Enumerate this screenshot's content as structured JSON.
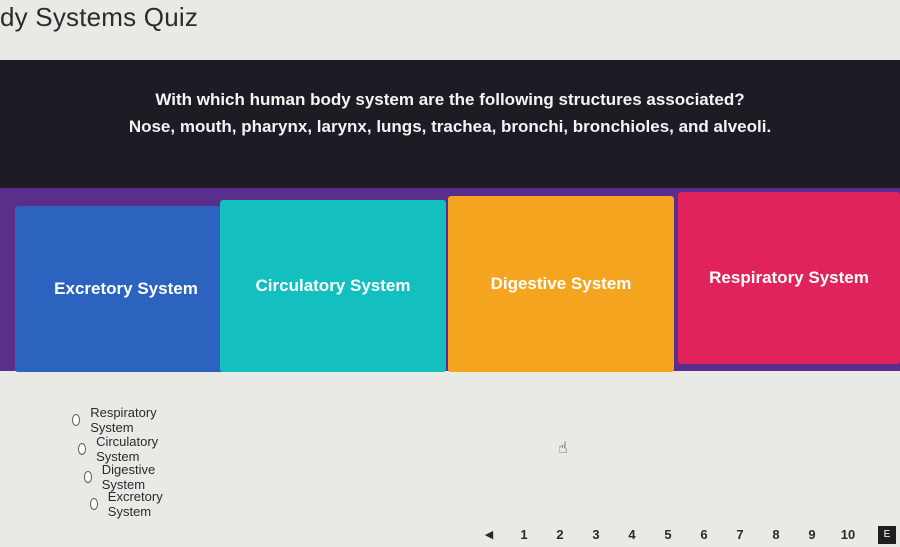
{
  "quiz": {
    "title": "dy Systems Quiz",
    "question_line1": "With which human body system are the following structures associated?",
    "question_line2": "Nose, mouth, pharynx, larynx, lungs, trachea, bronchi, bronchioles, and alveoli."
  },
  "answer_tiles": [
    {
      "label": "Excretory System",
      "color": "#2b63be"
    },
    {
      "label": "Circulatory System",
      "color": "#13bfbf"
    },
    {
      "label": "Digestive System",
      "color": "#f4a41f"
    },
    {
      "label": "Respiratory System",
      "color": "#e0245b"
    }
  ],
  "choices": [
    {
      "label": "Respiratory  System"
    },
    {
      "label": "Circulatory System"
    },
    {
      "label": "Digestive System"
    },
    {
      "label": "Excretory System"
    }
  ],
  "pager": {
    "prev_icon": "◀",
    "pages": [
      "1",
      "2",
      "3",
      "4",
      "5",
      "6",
      "7",
      "8",
      "9",
      "10"
    ],
    "end_icon_glyph": "E"
  }
}
